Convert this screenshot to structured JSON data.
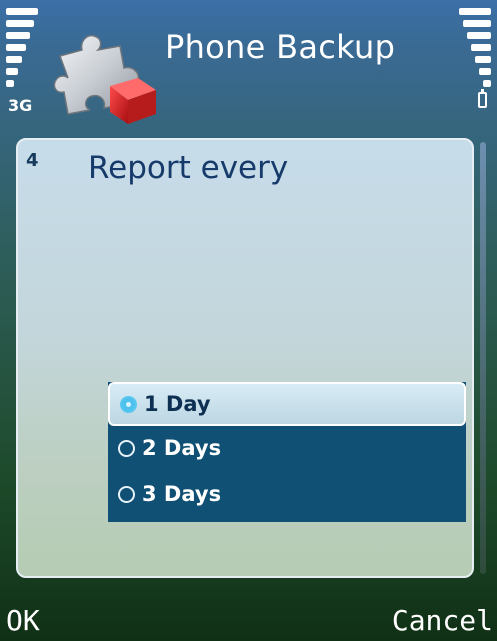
{
  "status": {
    "network": "3G"
  },
  "app": {
    "title": "Phone Backup",
    "icon": "puzzle-backup-icon"
  },
  "wizard": {
    "step": "4",
    "prompt": "Report every",
    "options": [
      {
        "label": "1 Day",
        "selected": true
      },
      {
        "label": "2 Days",
        "selected": false
      },
      {
        "label": "3 Days",
        "selected": false
      }
    ]
  },
  "softkeys": {
    "left": "OK",
    "right": "Cancel"
  },
  "colors": {
    "accent": "#4ec2ef",
    "list_bg": "#0f5074",
    "panel_text": "#163a6a"
  }
}
